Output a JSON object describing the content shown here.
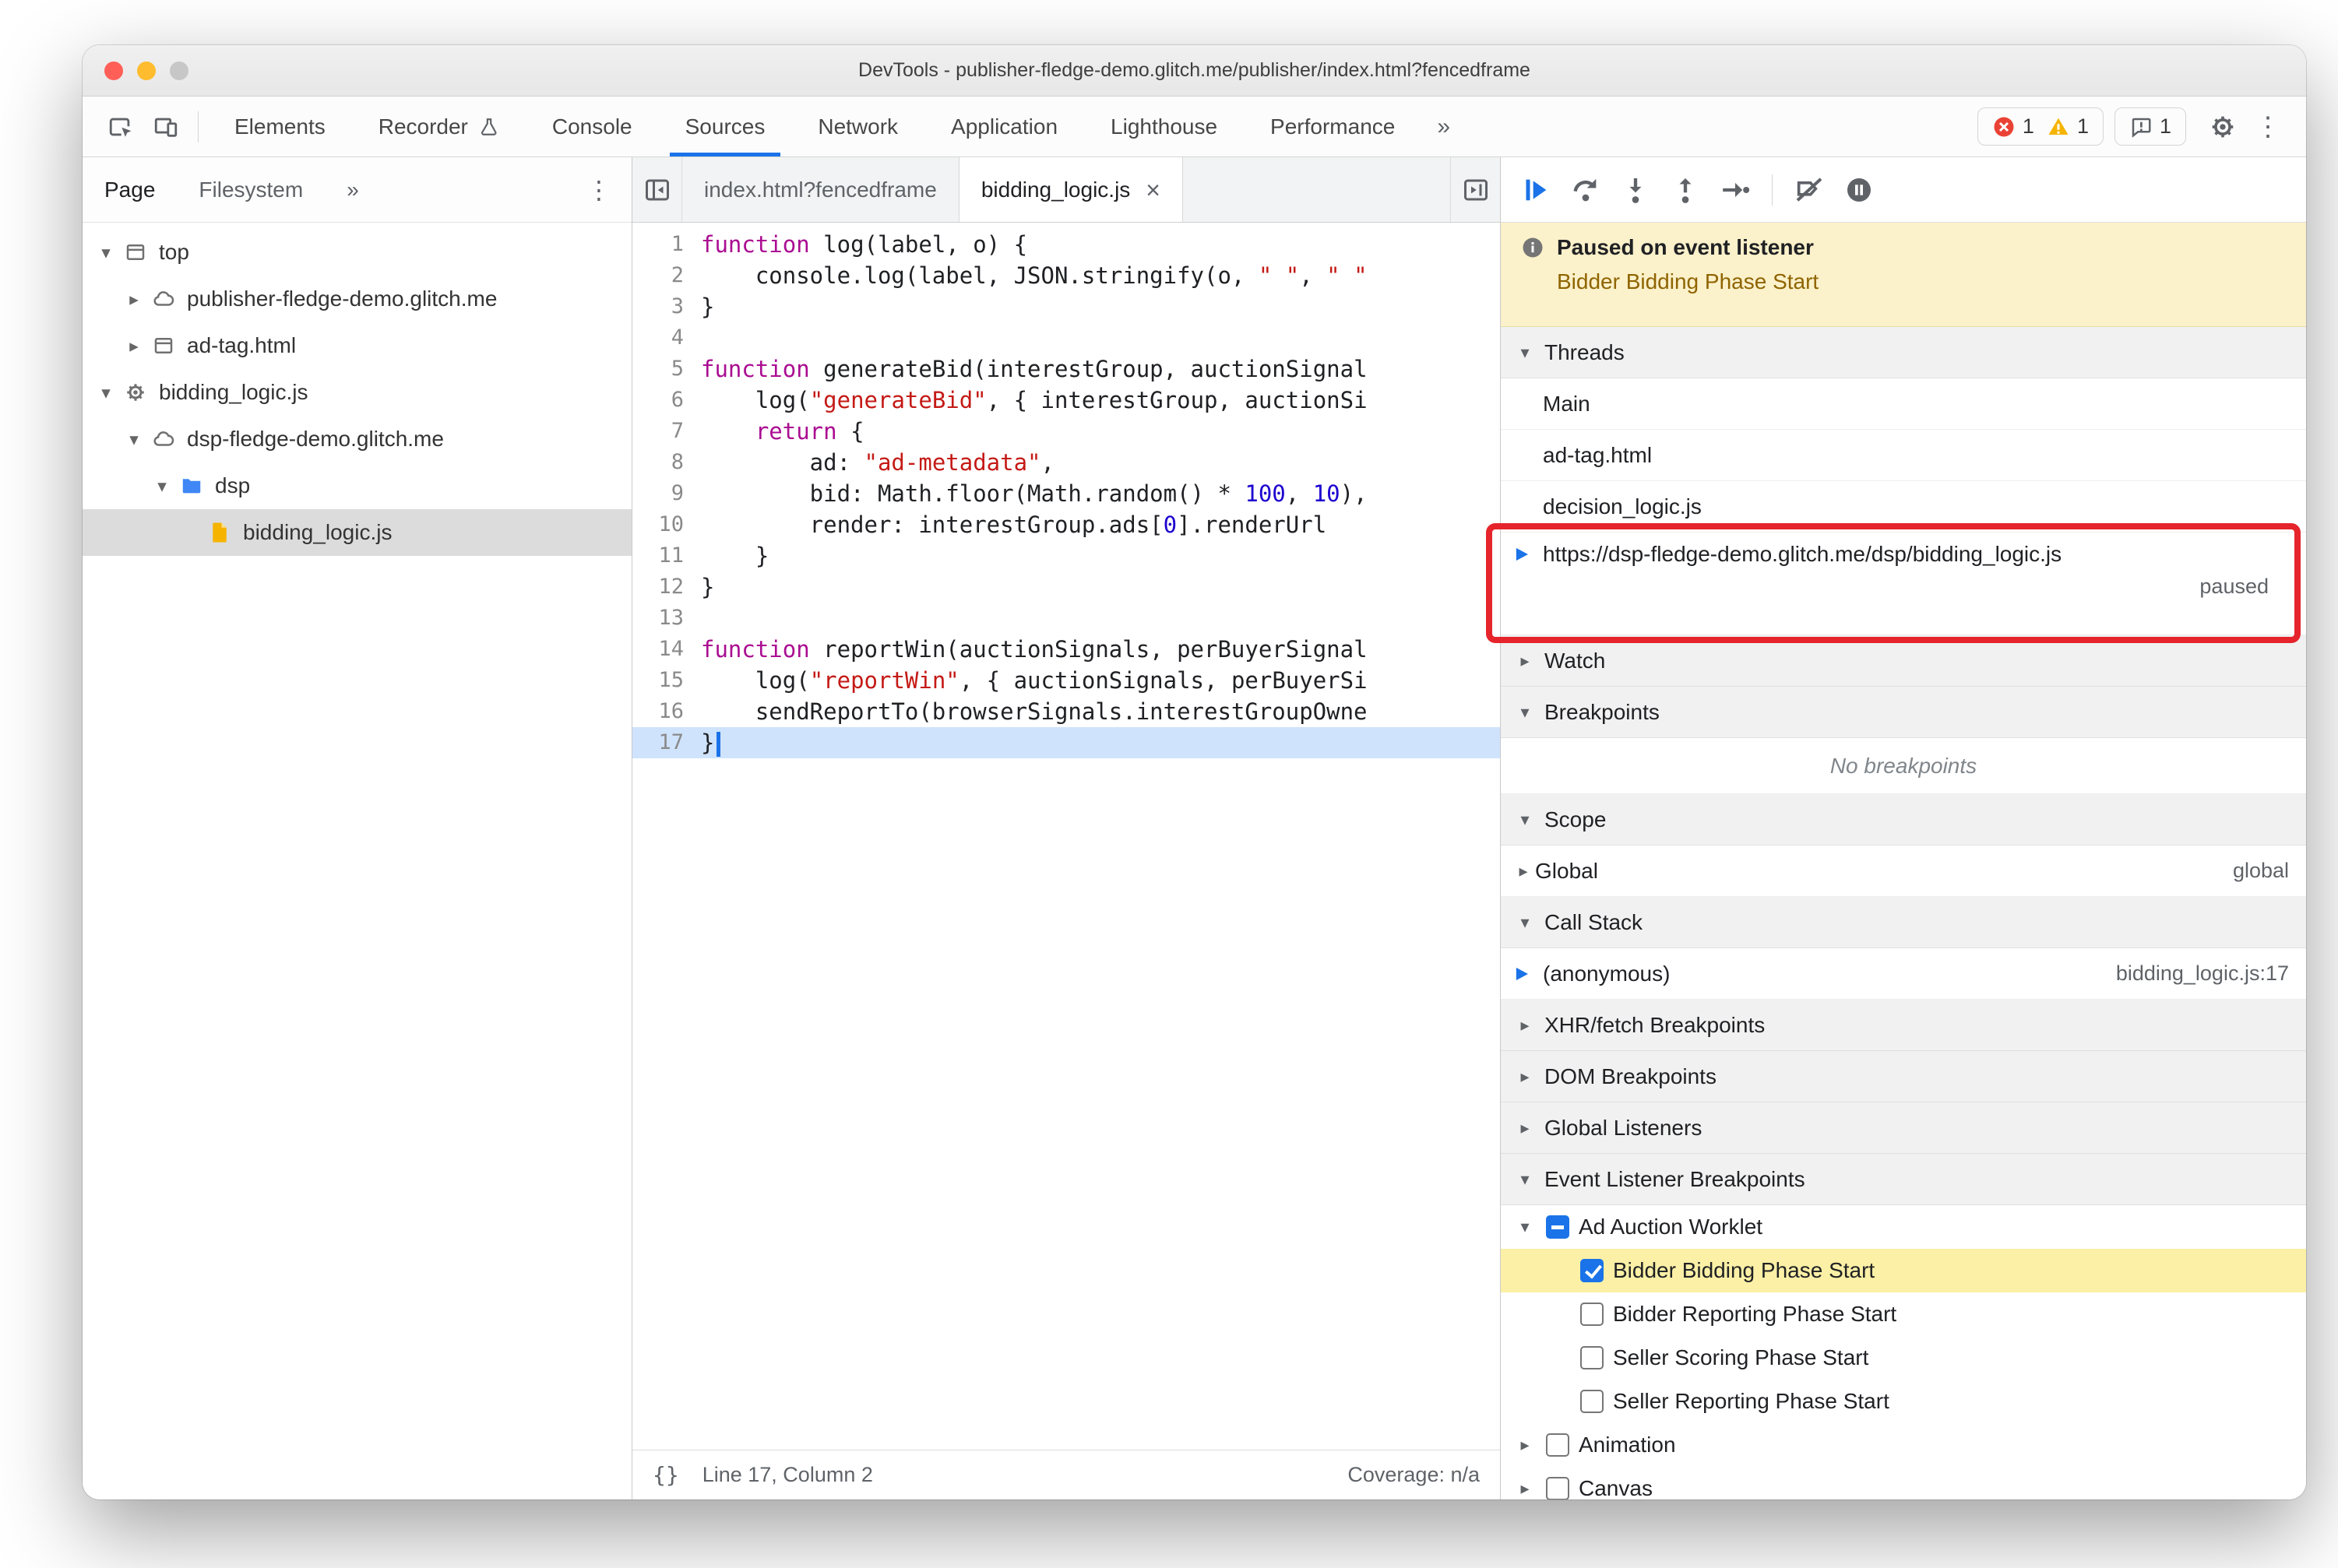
{
  "window": {
    "title": "DevTools - publisher-fledge-demo.glitch.me/publisher/index.html?fencedframe"
  },
  "colors": {
    "accent_blue": "#1a73e8",
    "error_red": "#e94235",
    "warning_yellow": "#f5b400",
    "annotation_red": "#e5242b",
    "paused_banner_bg": "#fbf1ca",
    "paused_line_bg": "#cfe3fc",
    "breakpoint_highlight_yellow": "#fbf0a6",
    "syntax_keyword": "#aa0d91",
    "syntax_string": "#c41a16",
    "syntax_number": "#1c00cf"
  },
  "main_toolbar": {
    "left_icons": [
      "inspect",
      "device-toolbar"
    ],
    "tabs": [
      {
        "label": "Elements"
      },
      {
        "label": "Recorder",
        "icon": "flask-icon"
      },
      {
        "label": "Console"
      },
      {
        "label": "Sources",
        "active": true
      },
      {
        "label": "Network"
      },
      {
        "label": "Application"
      },
      {
        "label": "Lighthouse"
      },
      {
        "label": "Performance"
      }
    ],
    "more_tabs_icon": "»",
    "errors": {
      "count": "1"
    },
    "warnings": {
      "count": "1"
    },
    "issues": {
      "count": "1"
    }
  },
  "navigator": {
    "tabs": [
      {
        "label": "Page",
        "active": true
      },
      {
        "label": "Filesystem"
      }
    ],
    "more_tabs_icon": "»",
    "overflow_icon": "⋮",
    "tree": [
      {
        "label": "top",
        "icon": "frame",
        "depth": 0,
        "expand": "open"
      },
      {
        "label": "publisher-fledge-demo.glitch.me",
        "icon": "cloud",
        "depth": 1,
        "expand": "closed"
      },
      {
        "label": "ad-tag.html",
        "icon": "frame",
        "depth": 1,
        "expand": "closed"
      },
      {
        "label": "bidding_logic.js",
        "icon": "worker",
        "depth": 0,
        "expand": "open"
      },
      {
        "label": "dsp-fledge-demo.glitch.me",
        "icon": "cloud",
        "depth": 1,
        "expand": "open"
      },
      {
        "label": "dsp",
        "icon": "folder",
        "depth": 2,
        "expand": "open"
      },
      {
        "label": "bidding_logic.js",
        "icon": "file",
        "depth": 3,
        "selected": true
      }
    ]
  },
  "editor": {
    "tabs": [
      {
        "label": "index.html?fencedframe"
      },
      {
        "label": "bidding_logic.js",
        "active": true,
        "close_icon": "×"
      }
    ],
    "code": [
      {
        "n": 1,
        "seg": [
          [
            "k",
            "function"
          ],
          [
            "p",
            " log(label, o) {"
          ]
        ]
      },
      {
        "n": 2,
        "seg": [
          [
            "p",
            "    console.log(label, JSON.stringify(o, "
          ],
          [
            "s",
            "\" \""
          ],
          [
            "p",
            ", "
          ],
          [
            "s",
            "\" \""
          ]
        ]
      },
      {
        "n": 3,
        "seg": [
          [
            "p",
            "}"
          ]
        ]
      },
      {
        "n": 4,
        "seg": []
      },
      {
        "n": 5,
        "seg": [
          [
            "k",
            "function"
          ],
          [
            "p",
            " generateBid(interestGroup, auctionSignal"
          ]
        ]
      },
      {
        "n": 6,
        "seg": [
          [
            "p",
            "    log("
          ],
          [
            "s",
            "\"generateBid\""
          ],
          [
            "p",
            ", { interestGroup, auctionSi"
          ]
        ]
      },
      {
        "n": 7,
        "seg": [
          [
            "p",
            "    "
          ],
          [
            "k",
            "return"
          ],
          [
            "p",
            " {"
          ]
        ]
      },
      {
        "n": 8,
        "seg": [
          [
            "p",
            "        ad: "
          ],
          [
            "s",
            "\"ad-metadata\""
          ],
          [
            "p",
            ","
          ]
        ]
      },
      {
        "n": 9,
        "seg": [
          [
            "p",
            "        bid: Math.floor(Math.random() * "
          ],
          [
            "d",
            "100"
          ],
          [
            "p",
            ", "
          ],
          [
            "d",
            "10"
          ],
          [
            "p",
            "),"
          ]
        ]
      },
      {
        "n": 10,
        "seg": [
          [
            "p",
            "        render: interestGroup.ads["
          ],
          [
            "d",
            "0"
          ],
          [
            "p",
            "].renderUrl"
          ]
        ]
      },
      {
        "n": 11,
        "seg": [
          [
            "p",
            "    }"
          ]
        ]
      },
      {
        "n": 12,
        "seg": [
          [
            "p",
            "}"
          ]
        ]
      },
      {
        "n": 13,
        "seg": []
      },
      {
        "n": 14,
        "seg": [
          [
            "k",
            "function"
          ],
          [
            "p",
            " reportWin(auctionSignals, perBuyerSignal"
          ]
        ]
      },
      {
        "n": 15,
        "seg": [
          [
            "p",
            "    log("
          ],
          [
            "s",
            "\"reportWin\""
          ],
          [
            "p",
            ", { auctionSignals, perBuyerSi"
          ]
        ]
      },
      {
        "n": 16,
        "seg": [
          [
            "p",
            "    sendReportTo(browserSignals.interestGroupOwne"
          ]
        ]
      },
      {
        "n": 17,
        "seg": [
          [
            "p",
            "}"
          ]
        ],
        "current": true
      }
    ],
    "status": {
      "pretty_print": "{}",
      "position": "Line 17, Column 2",
      "coverage": "Coverage: n/a"
    }
  },
  "debugger": {
    "toolbar_icons": [
      "resume",
      "step-over",
      "step-into",
      "step-out",
      "step",
      "separator",
      "deactivate-breakpoints",
      "pause-on-exceptions"
    ],
    "banner": {
      "title": "Paused on event listener",
      "subtitle": "Bidder Bidding Phase Start"
    },
    "threads": {
      "title": "Threads",
      "items": [
        {
          "label": "Main"
        },
        {
          "label": "ad-tag.html"
        },
        {
          "label": "decision_logic.js"
        },
        {
          "label": "https://dsp-fledge-demo.glitch.me/dsp/bidding_logic.js",
          "active": true,
          "status": "paused"
        }
      ]
    },
    "watch": {
      "title": "Watch"
    },
    "breakpoints": {
      "title": "Breakpoints",
      "empty": "No breakpoints"
    },
    "scope": {
      "title": "Scope",
      "rows": [
        {
          "label": "Global",
          "value": "global"
        }
      ]
    },
    "call_stack": {
      "title": "Call Stack",
      "frames": [
        {
          "label": "(anonymous)",
          "location": "bidding_logic.js:17",
          "active": true
        }
      ]
    },
    "xhr_breakpoints": {
      "title": "XHR/fetch Breakpoints"
    },
    "dom_breakpoints": {
      "title": "DOM Breakpoints"
    },
    "global_listeners": {
      "title": "Global Listeners"
    },
    "event_listener_breakpoints": {
      "title": "Event Listener Breakpoints",
      "categories": [
        {
          "label": "Ad Auction Worklet",
          "state": "indeterminate",
          "expanded": true,
          "children": [
            {
              "label": "Bidder Bidding Phase Start",
              "checked": true,
              "highlighted": true
            },
            {
              "label": "Bidder Reporting Phase Start",
              "checked": false
            },
            {
              "label": "Seller Scoring Phase Start",
              "checked": false
            },
            {
              "label": "Seller Reporting Phase Start",
              "checked": false
            }
          ]
        },
        {
          "label": "Animation",
          "state": "unchecked",
          "expanded": false,
          "children": []
        },
        {
          "label": "Canvas",
          "state": "unchecked",
          "expanded": false,
          "children": []
        }
      ]
    }
  }
}
